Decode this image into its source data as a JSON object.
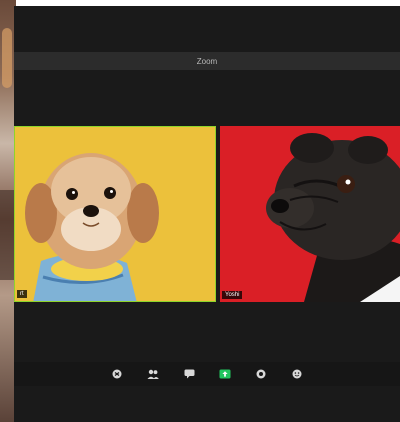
{
  "window": {
    "title": "Zoom"
  },
  "participants": [
    {
      "name": "rt",
      "background": "#ecc13b",
      "active_speaker": true
    },
    {
      "name": "Yoshi",
      "background": "#da1f26",
      "active_speaker": false
    }
  ],
  "toolbar": {
    "buttons": [
      {
        "icon": "security-icon"
      },
      {
        "icon": "participants-icon"
      },
      {
        "icon": "chat-icon"
      },
      {
        "icon": "share-screen-icon",
        "color": "#22c55e"
      },
      {
        "icon": "record-icon"
      },
      {
        "icon": "reactions-icon"
      }
    ]
  }
}
